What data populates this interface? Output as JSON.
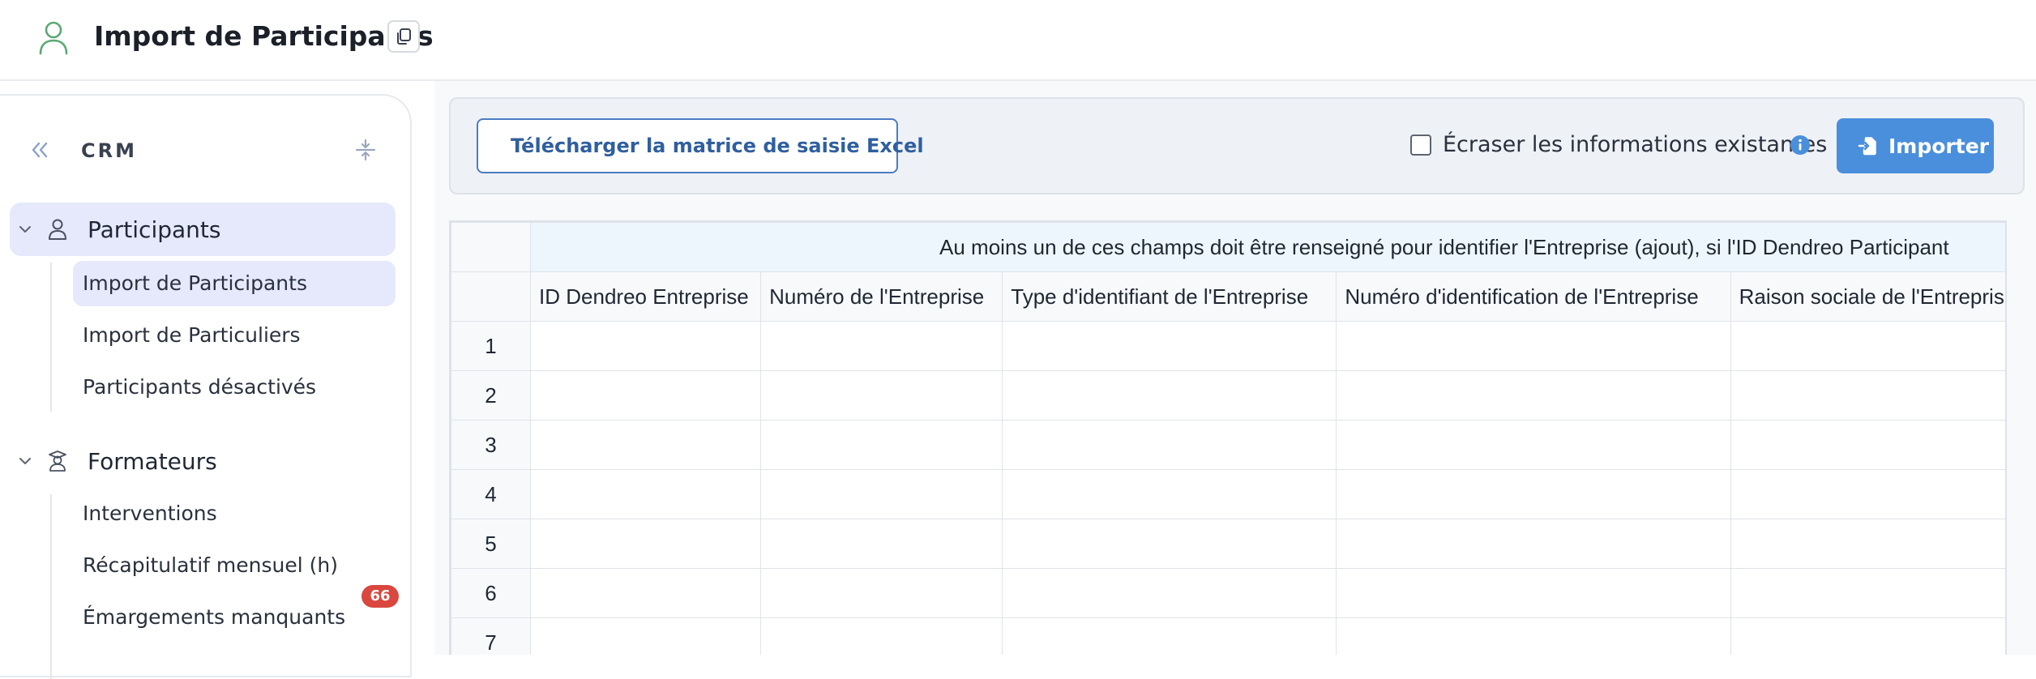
{
  "header": {
    "title": "Import de Participants"
  },
  "sidebar": {
    "section_title": "CRM",
    "groups": [
      {
        "label": "Participants",
        "items": [
          {
            "label": "Import de Participants"
          },
          {
            "label": "Import de Particuliers"
          },
          {
            "label": "Participants désactivés"
          }
        ]
      },
      {
        "label": "Formateurs",
        "items": [
          {
            "label": "Interventions"
          },
          {
            "label": "Récapitulatif mensuel (h)"
          },
          {
            "label": "Émargements manquants",
            "badge": "66"
          }
        ]
      }
    ]
  },
  "toolbar": {
    "download_label": "Télécharger la matrice de saisie Excel",
    "overwrite_label": "Écraser les informations existantes",
    "import_label": "Importer"
  },
  "grid": {
    "group_header": "Au moins un de ces champs doit être renseigné pour identifier l'Entreprise (ajout), si l'ID Dendreo Participant",
    "columns": [
      "ID Dendreo Entreprise",
      "Numéro de l'Entreprise",
      "Type d'identifiant de l'Entreprise",
      "Numéro d'identification de l'Entreprise",
      "Raison sociale de l'Entreprise"
    ],
    "rows": [
      "1",
      "2",
      "3",
      "4",
      "5",
      "6",
      "7"
    ]
  },
  "colors": {
    "accent": "#4a8fdc",
    "active_item_bg": "#e5e9fb",
    "badge": "#d9473f",
    "user_icon": "#5aa874"
  },
  "icons": {
    "header": "user-icon",
    "copy": "copy-icon",
    "collapse": "double-chevron-left-icon",
    "compress": "compress-vertical-icon",
    "participants": "person-icon",
    "formateurs": "teacher-icon",
    "download": "download-icon",
    "info": "info-icon",
    "import": "file-import-icon"
  }
}
